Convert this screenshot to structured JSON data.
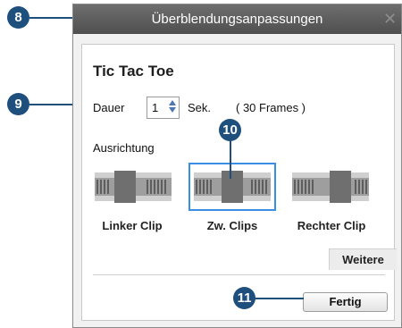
{
  "dialog": {
    "title": "Überblendungsanpassungen",
    "close_icon": "close-icon",
    "heading": "Tic Tac Toe"
  },
  "duration": {
    "label": "Dauer",
    "value": "1",
    "unit": "Sek.",
    "frames": "( 30 Frames )"
  },
  "alignment": {
    "label": "Ausrichtung",
    "options": [
      {
        "label": "Linker Clip",
        "icon": "align-left-clip-icon",
        "selected": false
      },
      {
        "label": "Zw. Clips",
        "icon": "align-between-clips-icon",
        "selected": true
      },
      {
        "label": "Rechter Clip",
        "icon": "align-right-clip-icon",
        "selected": false
      }
    ]
  },
  "buttons": {
    "more": "Weitere",
    "done": "Fertig"
  },
  "callouts": [
    "8",
    "9",
    "10",
    "11"
  ],
  "colors": {
    "callout": "#1f4f7d",
    "selection": "#3b8ee3",
    "titlebar": "#5a5a5a"
  }
}
